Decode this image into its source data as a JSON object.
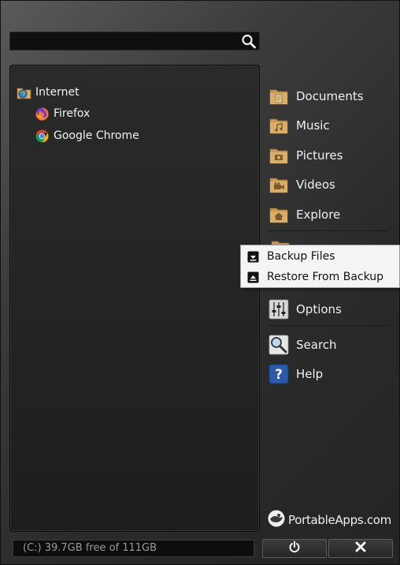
{
  "search": {
    "value": "",
    "placeholder": ""
  },
  "apps": {
    "category": "Internet",
    "items": [
      {
        "label": "Firefox",
        "icon": "firefox-icon"
      },
      {
        "label": "Google Chrome",
        "icon": "chrome-icon"
      }
    ]
  },
  "sidebar": {
    "items": [
      {
        "label": "Documents",
        "icon": "documents-folder-icon"
      },
      {
        "label": "Music",
        "icon": "music-folder-icon"
      },
      {
        "label": "Pictures",
        "icon": "pictures-folder-icon"
      },
      {
        "label": "Videos",
        "icon": "videos-folder-icon"
      },
      {
        "label": "Explore",
        "icon": "explore-folder-icon"
      },
      {
        "label": "Options",
        "icon": "options-icon"
      },
      {
        "label": "Search",
        "icon": "search-magnifier-icon"
      },
      {
        "label": "Help",
        "icon": "help-icon"
      }
    ]
  },
  "context_menu": {
    "items": [
      {
        "label": "Backup Files",
        "icon": "backup-icon"
      },
      {
        "label": "Restore From Backup",
        "icon": "restore-icon"
      }
    ]
  },
  "status": {
    "drive_info": "(C:) 39.7GB free of 111GB"
  },
  "logo": {
    "text": "PortableApps.com"
  },
  "colors": {
    "folder": "#c8a060",
    "accent_blue": "#2a5aa8",
    "background": "#2a2a2a"
  }
}
